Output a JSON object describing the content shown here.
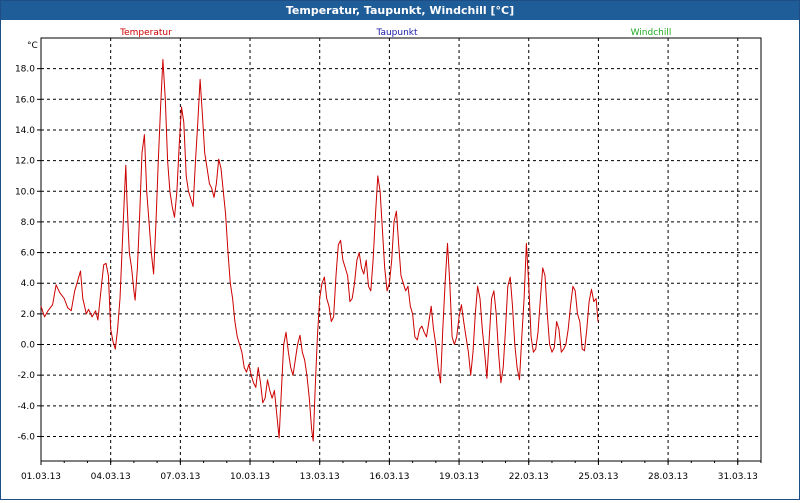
{
  "window": {
    "title": "Temperatur, Taupunkt, Windchill [°C]"
  },
  "colors": {
    "titlebar": "#1f5d99",
    "temperature": "#cc0000",
    "dewpoint": "#1a1aa8",
    "windchill": "#22aa22",
    "grid": "#000000"
  },
  "chart_data": {
    "type": "line",
    "title": "Temperatur, Taupunkt, Windchill [°C]",
    "ylabel": "°C",
    "xlabel": "",
    "grid": true,
    "legend_placement": "top",
    "ylim": [
      -7.6,
      20.0
    ],
    "xlim": [
      "01.03.13",
      "01.04.13"
    ],
    "y_ticks": [
      "18.0",
      "16.0",
      "14.0",
      "12.0",
      "10.0",
      "8.0",
      "6.0",
      "4.0",
      "2.0",
      "0.0",
      "-2.0",
      "-4.0",
      "-6.0"
    ],
    "x_ticks": [
      "01.03.13",
      "04.03.13",
      "07.03.13",
      "10.03.13",
      "13.03.13",
      "16.03.13",
      "19.03.13",
      "22.03.13",
      "25.03.13",
      "28.03.13",
      "31.03.13"
    ],
    "legend": [
      "Temperatur",
      "Taupunkt",
      "Windchill"
    ],
    "series": [
      {
        "name": "Temperatur",
        "color": "#cc0000",
        "x_unit": "days since 01.03.13",
        "points": [
          [
            0.0,
            2.5
          ],
          [
            0.15,
            1.8
          ],
          [
            0.3,
            2.2
          ],
          [
            0.5,
            2.6
          ],
          [
            0.65,
            3.9
          ],
          [
            0.8,
            3.4
          ],
          [
            1.0,
            3.0
          ],
          [
            1.15,
            2.4
          ],
          [
            1.3,
            2.2
          ],
          [
            1.45,
            3.5
          ],
          [
            1.55,
            4.0
          ],
          [
            1.7,
            4.8
          ],
          [
            1.8,
            3.0
          ],
          [
            1.95,
            2.0
          ],
          [
            2.05,
            2.3
          ],
          [
            2.2,
            1.8
          ],
          [
            2.35,
            2.2
          ],
          [
            2.45,
            1.6
          ],
          [
            2.6,
            3.8
          ],
          [
            2.7,
            5.2
          ],
          [
            2.8,
            5.3
          ],
          [
            2.9,
            4.5
          ],
          [
            3.0,
            1.0
          ],
          [
            3.1,
            0.2
          ],
          [
            3.2,
            -0.3
          ],
          [
            3.3,
            1.0
          ],
          [
            3.4,
            3.0
          ],
          [
            3.5,
            6.5
          ],
          [
            3.6,
            10.0
          ],
          [
            3.65,
            11.7
          ],
          [
            3.7,
            9.5
          ],
          [
            3.8,
            6.0
          ],
          [
            3.9,
            5.0
          ],
          [
            4.0,
            3.5
          ],
          [
            4.05,
            2.9
          ],
          [
            4.15,
            5.0
          ],
          [
            4.25,
            8.5
          ],
          [
            4.35,
            12.5
          ],
          [
            4.45,
            13.7
          ],
          [
            4.55,
            10.0
          ],
          [
            4.65,
            8.0
          ],
          [
            4.75,
            6.0
          ],
          [
            4.85,
            4.6
          ],
          [
            4.95,
            8.0
          ],
          [
            5.05,
            12.0
          ],
          [
            5.15,
            15.5
          ],
          [
            5.25,
            18.6
          ],
          [
            5.35,
            16.0
          ],
          [
            5.45,
            12.0
          ],
          [
            5.55,
            10.0
          ],
          [
            5.65,
            9.0
          ],
          [
            5.75,
            8.3
          ],
          [
            5.85,
            10.0
          ],
          [
            5.95,
            13.0
          ],
          [
            6.05,
            15.5
          ],
          [
            6.15,
            14.5
          ],
          [
            6.25,
            11.0
          ],
          [
            6.35,
            10.0
          ],
          [
            6.45,
            9.5
          ],
          [
            6.55,
            9.0
          ],
          [
            6.65,
            12.0
          ],
          [
            6.75,
            14.5
          ],
          [
            6.85,
            17.3
          ],
          [
            6.95,
            15.0
          ],
          [
            7.05,
            12.5
          ],
          [
            7.15,
            11.5
          ],
          [
            7.25,
            10.5
          ],
          [
            7.35,
            10.2
          ],
          [
            7.45,
            9.6
          ],
          [
            7.55,
            10.5
          ],
          [
            7.65,
            12.1
          ],
          [
            7.75,
            11.5
          ],
          [
            7.85,
            10.0
          ],
          [
            7.95,
            8.5
          ],
          [
            8.05,
            6.0
          ],
          [
            8.15,
            4.0
          ],
          [
            8.25,
            3.0
          ],
          [
            8.35,
            1.5
          ],
          [
            8.45,
            0.5
          ],
          [
            8.55,
            0.0
          ],
          [
            8.65,
            -0.5
          ],
          [
            8.75,
            -1.5
          ],
          [
            8.85,
            -1.8
          ],
          [
            8.95,
            -1.3
          ],
          [
            9.05,
            -2.0
          ],
          [
            9.15,
            -2.5
          ],
          [
            9.25,
            -2.8
          ],
          [
            9.35,
            -1.5
          ],
          [
            9.45,
            -2.5
          ],
          [
            9.55,
            -3.8
          ],
          [
            9.65,
            -3.5
          ],
          [
            9.75,
            -2.3
          ],
          [
            9.85,
            -3.0
          ],
          [
            9.95,
            -3.5
          ],
          [
            10.05,
            -3.0
          ],
          [
            10.15,
            -4.5
          ],
          [
            10.25,
            -6.1
          ],
          [
            10.35,
            -3.0
          ],
          [
            10.45,
            0.0
          ],
          [
            10.55,
            0.8
          ],
          [
            10.65,
            -0.5
          ],
          [
            10.75,
            -1.5
          ],
          [
            10.85,
            -2.0
          ],
          [
            10.95,
            -1.0
          ],
          [
            11.05,
            0.0
          ],
          [
            11.15,
            0.6
          ],
          [
            11.25,
            -0.5
          ],
          [
            11.35,
            -1.0
          ],
          [
            11.45,
            -2.0
          ],
          [
            11.55,
            -3.5
          ],
          [
            11.65,
            -5.5
          ],
          [
            11.72,
            -6.3
          ],
          [
            11.8,
            -3.0
          ],
          [
            11.9,
            0.5
          ],
          [
            12.0,
            3.0
          ],
          [
            12.1,
            4.0
          ],
          [
            12.2,
            4.4
          ],
          [
            12.3,
            3.0
          ],
          [
            12.4,
            2.5
          ],
          [
            12.5,
            1.5
          ],
          [
            12.6,
            1.8
          ],
          [
            12.7,
            4.5
          ],
          [
            12.8,
            6.5
          ],
          [
            12.9,
            6.8
          ],
          [
            13.0,
            5.5
          ],
          [
            13.1,
            5.0
          ],
          [
            13.2,
            4.5
          ],
          [
            13.3,
            2.8
          ],
          [
            13.4,
            3.0
          ],
          [
            13.5,
            4.0
          ],
          [
            13.6,
            5.5
          ],
          [
            13.7,
            6.0
          ],
          [
            13.8,
            5.0
          ],
          [
            13.9,
            4.6
          ],
          [
            14.0,
            5.5
          ],
          [
            14.1,
            3.8
          ],
          [
            14.2,
            3.5
          ],
          [
            14.3,
            5.5
          ],
          [
            14.4,
            8.5
          ],
          [
            14.5,
            11.0
          ],
          [
            14.6,
            10.0
          ],
          [
            14.7,
            7.5
          ],
          [
            14.8,
            5.0
          ],
          [
            14.9,
            3.5
          ],
          [
            15.0,
            4.0
          ],
          [
            15.1,
            5.5
          ],
          [
            15.2,
            8.0
          ],
          [
            15.3,
            8.7
          ],
          [
            15.4,
            6.5
          ],
          [
            15.5,
            4.5
          ],
          [
            15.6,
            4.0
          ],
          [
            15.7,
            3.5
          ],
          [
            15.8,
            3.8
          ],
          [
            15.9,
            2.5
          ],
          [
            16.0,
            2.0
          ],
          [
            16.1,
            0.5
          ],
          [
            16.2,
            0.3
          ],
          [
            16.3,
            1.0
          ],
          [
            16.4,
            1.2
          ],
          [
            16.5,
            0.8
          ],
          [
            16.6,
            0.5
          ],
          [
            16.7,
            1.5
          ],
          [
            16.8,
            2.5
          ],
          [
            16.9,
            1.0
          ],
          [
            17.0,
            0.0
          ],
          [
            17.1,
            -1.5
          ],
          [
            17.2,
            -2.5
          ],
          [
            17.3,
            1.0
          ],
          [
            17.4,
            4.0
          ],
          [
            17.5,
            6.6
          ],
          [
            17.6,
            4.0
          ],
          [
            17.7,
            0.5
          ],
          [
            17.8,
            0.0
          ],
          [
            17.9,
            0.5
          ],
          [
            18.0,
            1.8
          ],
          [
            18.1,
            2.6
          ],
          [
            18.2,
            1.5
          ],
          [
            18.3,
            0.5
          ],
          [
            18.4,
            -0.5
          ],
          [
            18.5,
            -2.0
          ],
          [
            18.6,
            -0.5
          ],
          [
            18.7,
            2.0
          ],
          [
            18.8,
            3.8
          ],
          [
            18.9,
            3.0
          ],
          [
            19.0,
            1.0
          ],
          [
            19.1,
            -0.5
          ],
          [
            19.2,
            -2.2
          ],
          [
            19.3,
            0.5
          ],
          [
            19.4,
            3.0
          ],
          [
            19.5,
            3.5
          ],
          [
            19.6,
            2.0
          ],
          [
            19.7,
            -0.5
          ],
          [
            19.8,
            -2.5
          ],
          [
            19.9,
            -1.5
          ],
          [
            20.0,
            1.0
          ],
          [
            20.1,
            3.8
          ],
          [
            20.2,
            4.4
          ],
          [
            20.3,
            2.5
          ],
          [
            20.4,
            0.0
          ],
          [
            20.5,
            -1.5
          ],
          [
            20.6,
            -2.3
          ],
          [
            20.7,
            0.5
          ],
          [
            20.8,
            3.0
          ],
          [
            20.9,
            6.6
          ],
          [
            21.0,
            4.0
          ],
          [
            21.1,
            0.5
          ],
          [
            21.2,
            -0.5
          ],
          [
            21.3,
            -0.3
          ],
          [
            21.4,
            0.8
          ],
          [
            21.5,
            3.0
          ],
          [
            21.6,
            5.0
          ],
          [
            21.7,
            4.5
          ],
          [
            21.8,
            2.0
          ],
          [
            21.9,
            0.0
          ],
          [
            22.0,
            -0.5
          ],
          [
            22.1,
            -0.2
          ],
          [
            22.2,
            1.5
          ],
          [
            22.3,
            1.0
          ],
          [
            22.4,
            -0.5
          ],
          [
            22.5,
            -0.3
          ],
          [
            22.6,
            0.0
          ],
          [
            22.7,
            1.0
          ],
          [
            22.8,
            2.5
          ],
          [
            22.9,
            3.8
          ],
          [
            23.0,
            3.5
          ],
          [
            23.1,
            2.0
          ],
          [
            23.2,
            1.5
          ],
          [
            23.3,
            -0.3
          ],
          [
            23.4,
            -0.4
          ],
          [
            23.5,
            1.0
          ],
          [
            23.6,
            2.8
          ],
          [
            23.7,
            3.6
          ],
          [
            23.8,
            2.8
          ],
          [
            23.9,
            3.0
          ],
          [
            23.98,
            1.5
          ]
        ]
      }
    ]
  }
}
